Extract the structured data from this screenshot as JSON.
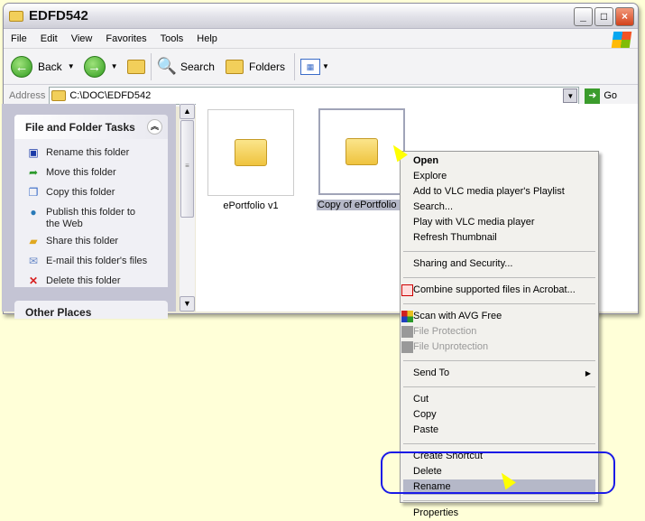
{
  "window": {
    "title": "EDFD542"
  },
  "menubar": [
    "File",
    "Edit",
    "View",
    "Favorites",
    "Tools",
    "Help"
  ],
  "toolbar": {
    "back": "Back",
    "search": "Search",
    "folders": "Folders"
  },
  "address": {
    "label": "Address",
    "value": "C:\\DOC\\EDFD542",
    "go": "Go"
  },
  "tasks": {
    "title": "File and Folder Tasks",
    "items": [
      {
        "label": "Rename this folder",
        "icon": "rename-icon"
      },
      {
        "label": "Move this folder",
        "icon": "move-icon"
      },
      {
        "label": "Copy this folder",
        "icon": "copy-icon"
      },
      {
        "label": "Publish this folder to the Web",
        "icon": "globe-icon"
      },
      {
        "label": "Share this folder",
        "icon": "share-icon"
      },
      {
        "label": "E-mail this folder's files",
        "icon": "email-icon"
      },
      {
        "label": "Delete this folder",
        "icon": "delete-icon"
      }
    ]
  },
  "other_places": {
    "title": "Other Places"
  },
  "files": [
    {
      "name": "ePortfolio v1"
    },
    {
      "name": "Copy of ePortfolio"
    }
  ],
  "context_menu": {
    "items": [
      "Open",
      "Explore",
      "Add to VLC media player's Playlist",
      "Search...",
      "Play with VLC media player",
      "Refresh Thumbnail",
      "Sharing and Security...",
      "Combine supported files in Acrobat...",
      "Scan with AVG Free",
      "File Protection",
      "File Unprotection",
      "Send To",
      "Cut",
      "Copy",
      "Paste",
      "Create Shortcut",
      "Delete",
      "Rename",
      "Properties"
    ],
    "highlighted": "Rename"
  },
  "colors": {
    "background": "#ffffd8",
    "highlight_ring": "#1a1ae6",
    "menu_highlight": "#b5b8c8"
  }
}
